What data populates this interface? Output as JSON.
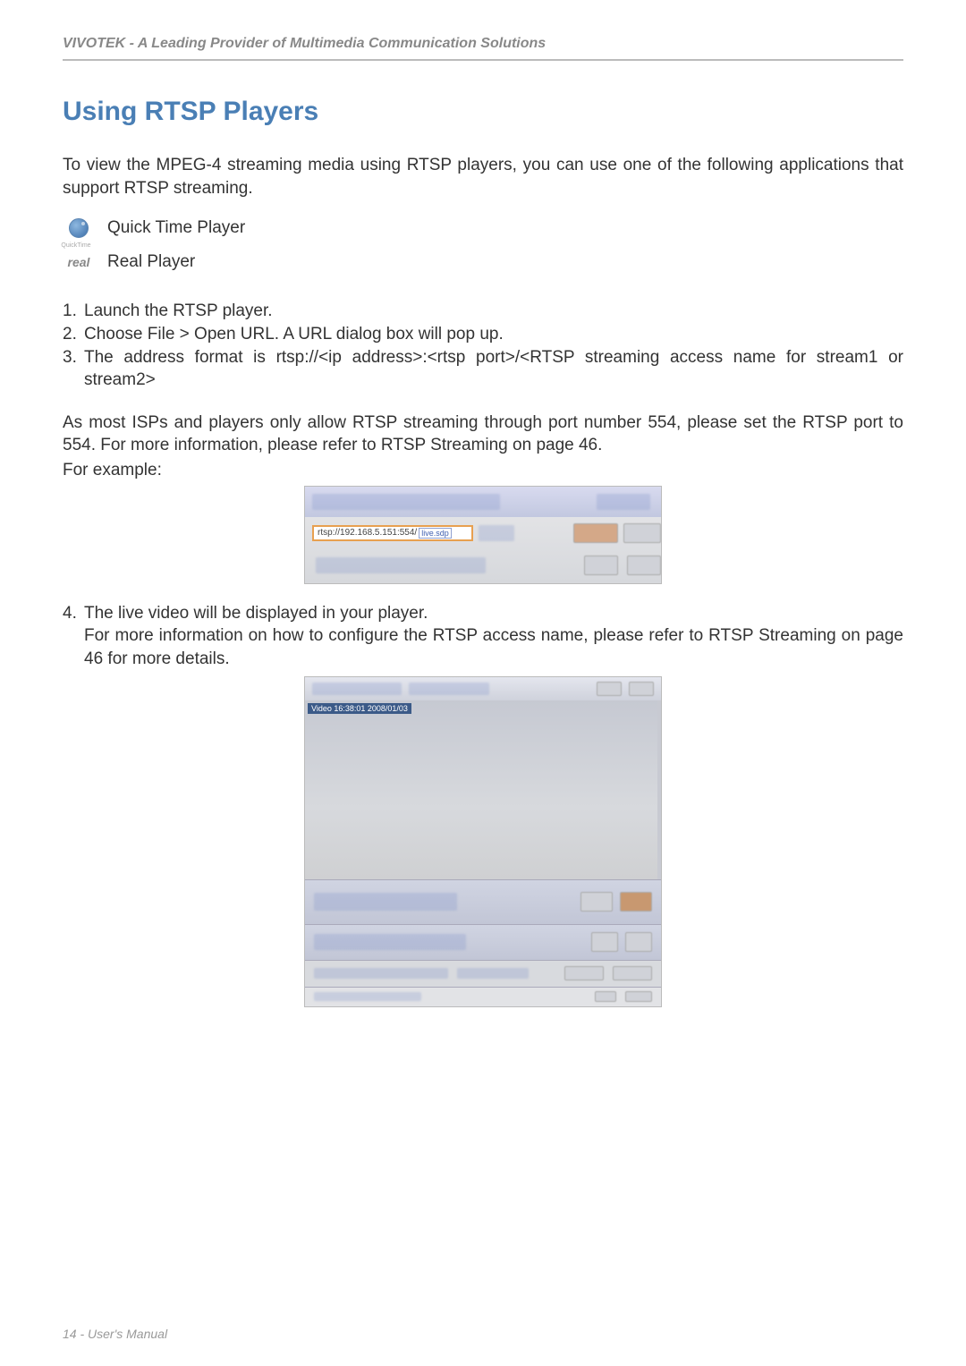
{
  "header": "VIVOTEK - A Leading Provider of Multimedia Communication Solutions",
  "title": "Using RTSP Players",
  "intro": "To view the MPEG-4 streaming media using RTSP players, you can use one of the following applications that support RTSP streaming.",
  "players": {
    "quicktime": "Quick Time Player",
    "real": "Real Player"
  },
  "steps": {
    "s1": "Launch the RTSP player.",
    "s2": "Choose File > Open URL. A URL dialog box will pop up.",
    "s3": "The address format is rtsp://<ip address>:<rtsp port>/<RTSP streaming access name for stream1 or stream2>"
  },
  "note": "As most ISPs and players only allow RTSP streaming through port number 554, please set the RTSP port to 554. For more information, please refer to RTSP Streaming on page 46.",
  "for_example": "For example:",
  "url_example_prefix": "rtsp://192.168.5.151:554/",
  "url_example_suffix": "live.sdp",
  "step4a": "The live video will be displayed in your player.",
  "step4b": "For more information on how to configure the RTSP access name, please refer to RTSP Streaming on page 46 for more details.",
  "video_overlay": "Video 16:38:01 2008/01/03",
  "footer": "14 - User's Manual"
}
